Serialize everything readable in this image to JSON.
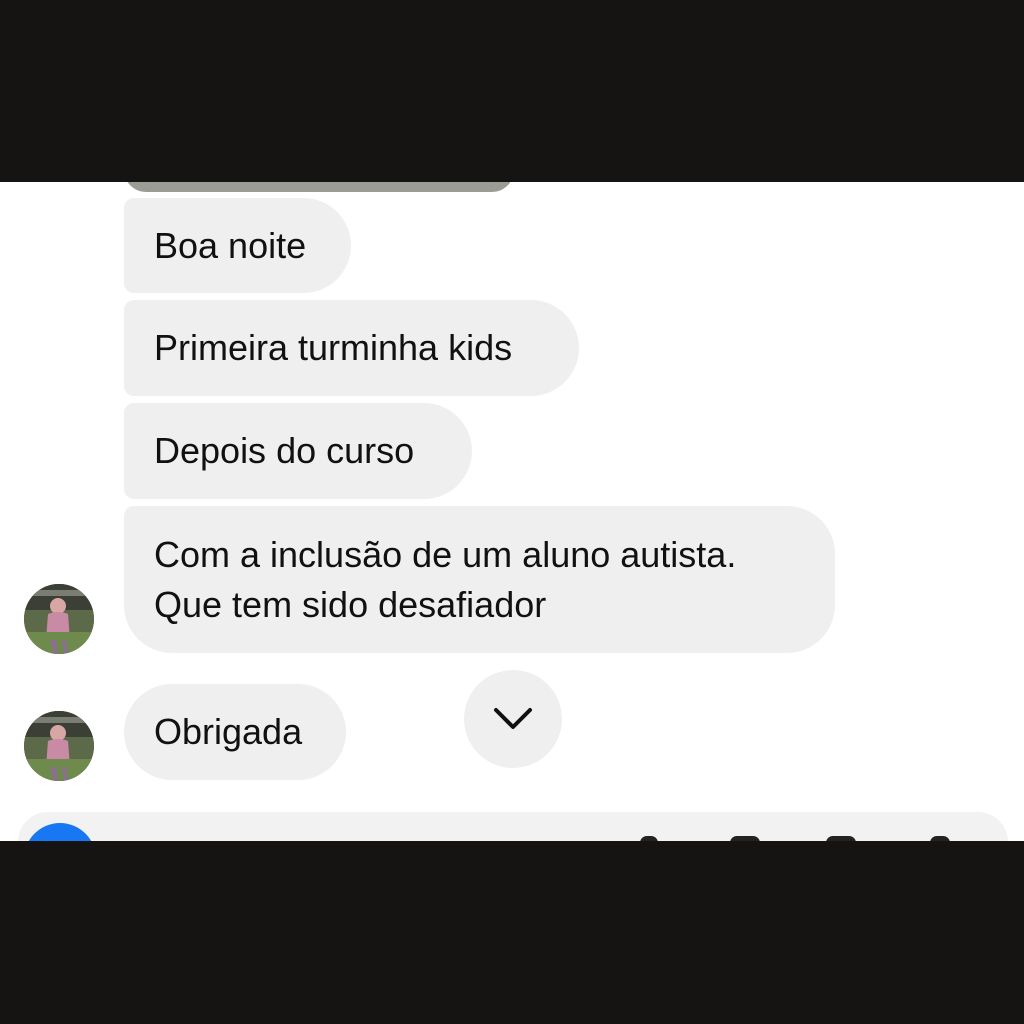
{
  "messages": [
    {
      "text": "Boa noite"
    },
    {
      "text": "Primeira turminha kids"
    },
    {
      "text": "Depois do curso"
    },
    {
      "lines": [
        "Com a inclusão de um aluno autista.",
        "Que tem sido desafiador"
      ]
    },
    {
      "text": "Obrigada"
    }
  ],
  "icons": {
    "scroll_down": "chevron-down-icon",
    "avatar": "user-avatar",
    "composer_action": "plus-circle-icon"
  },
  "colors": {
    "bubble_bg": "#efefef",
    "page_bg": "#ffffff",
    "letterbox": "#151412",
    "accent": "#1877f2"
  }
}
